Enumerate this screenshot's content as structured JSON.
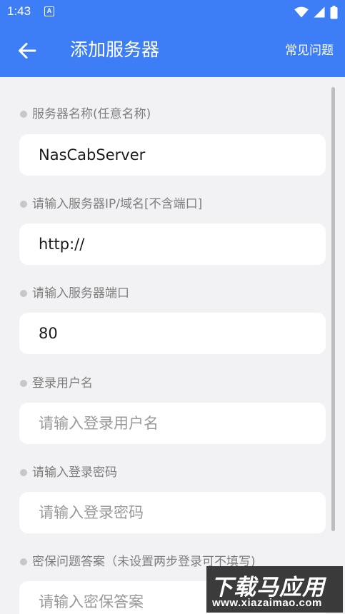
{
  "status_bar": {
    "time": "1:43",
    "notification_letter": "A"
  },
  "app_bar": {
    "title": "添加服务器",
    "faq_label": "常见问题"
  },
  "form": {
    "server_name": {
      "label": "服务器名称(任意名称)",
      "value": "NasCabServer",
      "placeholder": ""
    },
    "server_address": {
      "label": "请输入服务器IP/域名[不含端口]",
      "value": "http://",
      "placeholder": ""
    },
    "server_port": {
      "label": "请输入服务器端口",
      "value": "80",
      "placeholder": ""
    },
    "username": {
      "label": "登录用户名",
      "value": "",
      "placeholder": "请输入登录用户名"
    },
    "password": {
      "label": "请输入登录密码",
      "value": "",
      "placeholder": "请输入登录密码"
    },
    "security_answer": {
      "label": "密保问题答案（未设置两步登录可不填写)",
      "value": "",
      "placeholder": "请输入密保答案"
    }
  },
  "watermark": {
    "title": "下载马应用",
    "url": "www.xiazaimao.com"
  },
  "colors": {
    "accent": "#3d7df5",
    "background": "#f2f2f4",
    "field": "#ffffff",
    "label": "#7d7d7d"
  }
}
